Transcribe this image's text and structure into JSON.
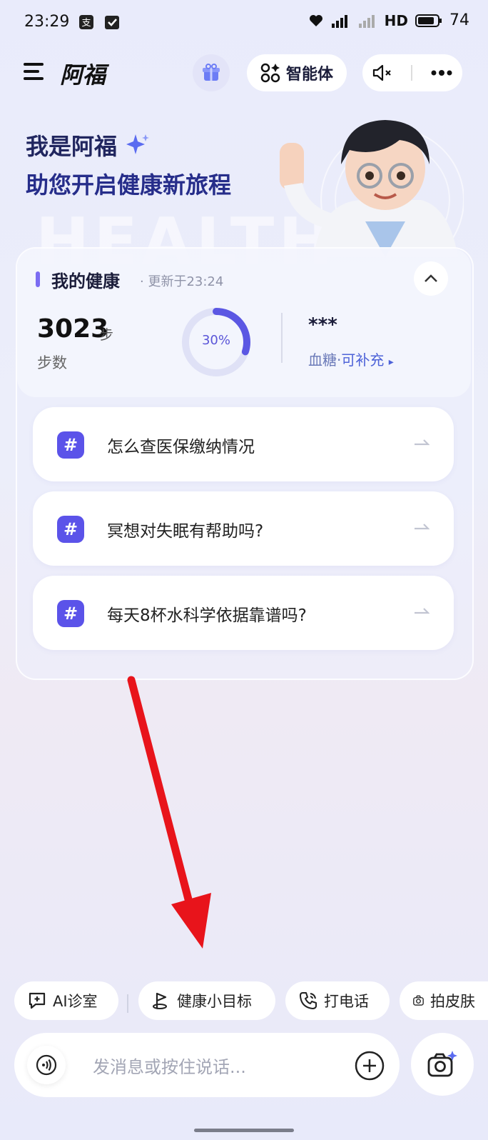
{
  "status_bar": {
    "time": "23:29",
    "hd": "HD",
    "battery": "74"
  },
  "header": {
    "title": "阿福",
    "agent_label": "智能体"
  },
  "hero": {
    "line1": "我是阿福",
    "line2": "助您开启健康新旅程",
    "watermark": "HEALTH"
  },
  "health_card": {
    "title": "我的健康",
    "updated": "· 更新于23:24",
    "steps_value": "3023",
    "steps_unit": "步",
    "steps_label": "步数",
    "progress": 0.3,
    "progress_label": "30%",
    "blood_sugar_value": "***",
    "blood_sugar_label": "血糖·",
    "blood_sugar_action": "可补充",
    "blood_sugar_arrow": "▸"
  },
  "questions": [
    "怎么查医保缴纳情况",
    "冥想对失眠有帮助吗?",
    "每天8杯水科学依据靠谱吗?"
  ],
  "shortcuts": {
    "ai_clinic": "AI诊室",
    "health_goal": "健康小目标",
    "call": "打电话",
    "skin_photo": "拍皮肤"
  },
  "input": {
    "placeholder": "发消息或按住说话..."
  },
  "annotation_color": "#e8141b"
}
